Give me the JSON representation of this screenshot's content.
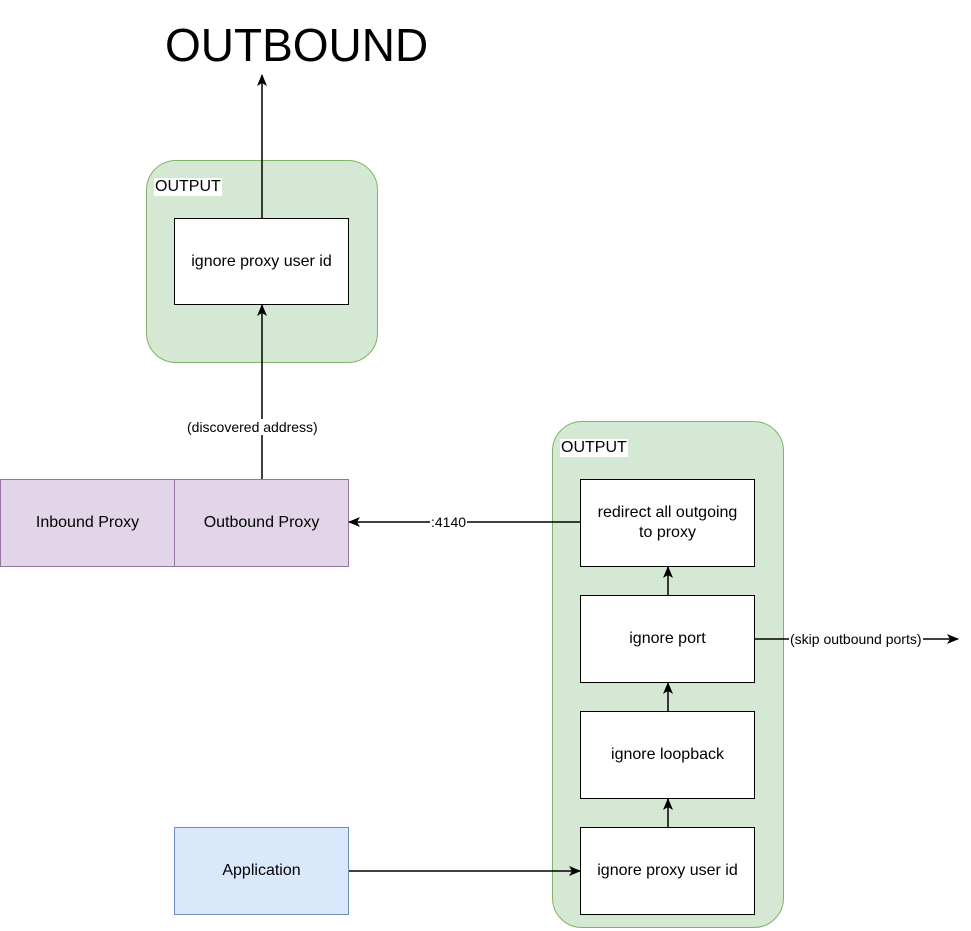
{
  "title": "OUTBOUND",
  "top_group": {
    "label": "OUTPUT",
    "nodes": [
      {
        "label": "ignore proxy user id"
      }
    ]
  },
  "proxies": {
    "inbound": "Inbound Proxy",
    "outbound": "Outbound Proxy"
  },
  "right_group": {
    "label": "OUTPUT",
    "nodes": [
      {
        "label": "redirect all outgoing to proxy"
      },
      {
        "label": "ignore port"
      },
      {
        "label": "ignore loopback"
      },
      {
        "label": "ignore proxy user id"
      }
    ]
  },
  "application": "Application",
  "edge_labels": {
    "discovered": "(discovered address)",
    "port": ":4140",
    "skip": "(skip outbound ports)"
  },
  "colors": {
    "group_fill": "#d5e8d4",
    "group_stroke": "#82b366",
    "proxy_fill": "#e1d5e7",
    "proxy_stroke": "#9673a6",
    "app_fill": "#dae8fc",
    "app_stroke": "#6c8ebf"
  }
}
